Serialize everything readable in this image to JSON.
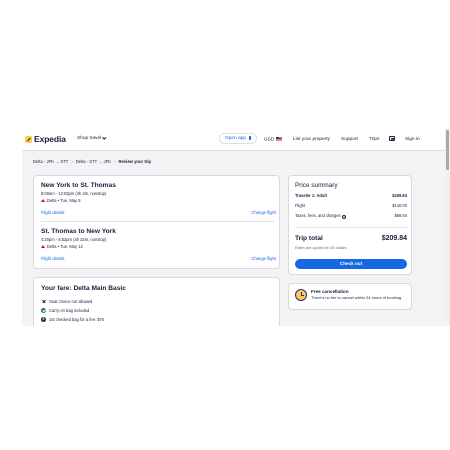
{
  "header": {
    "logo_text": "Expedia",
    "shop_travel": "Shop travel",
    "open_app": "Open app",
    "currency": "USD",
    "list_property": "List your property",
    "support": "Support",
    "trips": "Trips",
    "sign_in": "Sign in"
  },
  "breadcrumb": {
    "step1": "Delta · JFK → STT",
    "step2": "Delta · STT → JFK",
    "current": "Review your trip"
  },
  "flights": [
    {
      "title": "New York to St. Thomas",
      "time": "8:00am - 12:03pm (4h 3m, nonstop)",
      "airline": "Delta • Tue, May 5",
      "details_link": "Flight details",
      "change_link": "Change flight"
    },
    {
      "title": "St. Thomas to New York",
      "time": "4:20pm - 8:52pm (4h 32m, nonstop)",
      "airline": "Delta • Tue, May 12",
      "details_link": "Flight details",
      "change_link": "Change flight"
    }
  ],
  "fare": {
    "title": "Your fare: Delta Main Basic",
    "items": [
      {
        "text": "Seat choice not allowed",
        "icon": "x-icon"
      },
      {
        "text": "Carry-on bag included",
        "icon": "check-icon"
      },
      {
        "text": "1st checked bag for a fee: $70",
        "icon": "dollar-icon"
      }
    ]
  },
  "summary": {
    "title": "Price summary",
    "traveler_label": "Traveler 1: Adult",
    "traveler_value": "$209.84",
    "flight_label": "Flight",
    "flight_value": "$140.00",
    "taxes_label": "Taxes, fees, and charges",
    "taxes_value": "$69.84",
    "total_label": "Trip total",
    "total_value": "$209.84",
    "rates_note": "Rates are quoted in US dollars",
    "checkout": "Check out"
  },
  "cancellation": {
    "title": "Free cancellation",
    "text": "There's no fee to cancel within 24 hours of booking."
  },
  "colors": {
    "brand_blue": "#1668e3",
    "logo_yellow": "#ffc94c",
    "text_dark": "#191e3b",
    "delta_red": "#c8102e",
    "success_green": "#227950"
  }
}
